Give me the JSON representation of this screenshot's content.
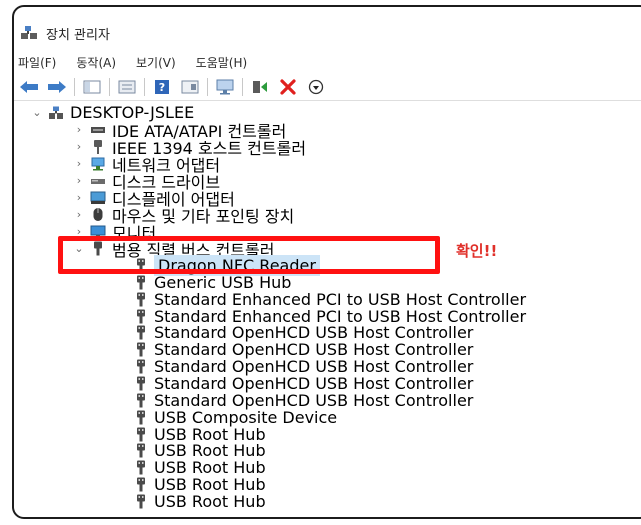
{
  "window": {
    "title": "장치 관리자"
  },
  "menu": [
    "파일(F)",
    "동작(A)",
    "보기(V)",
    "도움말(H)"
  ],
  "tree": {
    "root": "DESKTOP-JSLEE",
    "categories": [
      "IDE ATA/ATAPI 컨트롤러",
      "IEEE 1394 호스트 컨트롤러",
      "네트워크 어댑터",
      "디스크 드라이브",
      "디스플레이 어댑터",
      "마우스 및 기타 포인팅 장치",
      "모니터",
      "범용 직렬 버스 컨트롤러"
    ],
    "usb_devices": [
      "Dragon NFC Reader",
      "Generic USB Hub",
      "Standard Enhanced PCI to USB Host Controller",
      "Standard Enhanced PCI to USB Host Controller",
      "Standard OpenHCD USB Host Controller",
      "Standard OpenHCD USB Host Controller",
      "Standard OpenHCD USB Host Controller",
      "Standard OpenHCD USB Host Controller",
      "Standard OpenHCD USB Host Controller",
      "USB Composite Device",
      "USB Root Hub",
      "USB Root Hub",
      "USB Root Hub",
      "USB Root Hub",
      "USB Root Hub"
    ]
  },
  "annotation": {
    "text": "확인!!",
    "color": "#e0302a"
  },
  "colors": {
    "highlight": "#ff1111",
    "selection": "#cce4f7"
  }
}
